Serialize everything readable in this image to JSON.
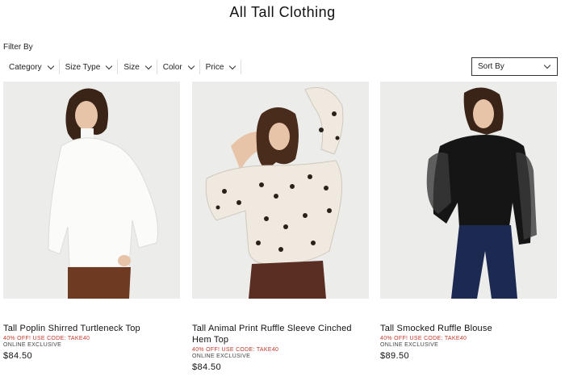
{
  "page": {
    "title": "All Tall Clothing"
  },
  "filters": {
    "label": "Filter By",
    "items": [
      {
        "label": "Category"
      },
      {
        "label": "Size Type"
      },
      {
        "label": "Size"
      },
      {
        "label": "Color"
      },
      {
        "label": "Price"
      }
    ],
    "sort_label": "Sort By"
  },
  "products": [
    {
      "name": "Tall Poplin Shirred Turtleneck Top",
      "promo": "40% OFF! USE CODE: TAKE40",
      "tag": "ONLINE EXCLUSIVE",
      "price": "$84.50"
    },
    {
      "name": "Tall Animal Print Ruffle Sleeve Cinched Hem Top",
      "promo": "40% OFF! USE CODE: TAKE40",
      "tag": "ONLINE EXCLUSIVE",
      "price": "$84.50"
    },
    {
      "name": "Tall Smocked Ruffle Blouse",
      "promo": "40% OFF! USE CODE: TAKE40",
      "tag": "ONLINE EXCLUSIVE",
      "price": "$89.50"
    }
  ],
  "colors": {
    "promo": "#c0392b",
    "photo_bg": "#ececea"
  }
}
